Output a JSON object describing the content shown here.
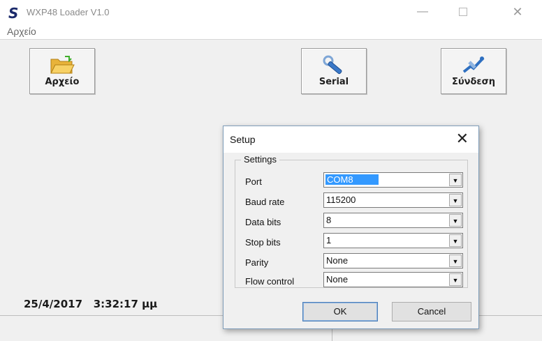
{
  "window": {
    "logo": "S",
    "title": "WXP48 Loader V1.0",
    "controls": {
      "minimize": "—",
      "close": "✕"
    }
  },
  "menu": {
    "items": [
      "Αρχείο"
    ]
  },
  "toolbar": {
    "buttons": [
      {
        "label": "Αρχείο",
        "icon": "folder-open-icon"
      },
      {
        "label": "Serial",
        "icon": "wrench-icon"
      },
      {
        "label": "Σύνδεση",
        "icon": "connection-icon"
      }
    ]
  },
  "status": {
    "date": "25/4/2017",
    "time": "3:32:17 μμ"
  },
  "dialog": {
    "title": "Setup",
    "close": "✕",
    "group_title": "Settings",
    "rows": [
      {
        "label": "Port",
        "value": "COM8"
      },
      {
        "label": "Baud rate",
        "value": "115200"
      },
      {
        "label": "Data bits",
        "value": "8"
      },
      {
        "label": "Stop bits",
        "value": "1"
      },
      {
        "label": "Parity",
        "value": "None"
      },
      {
        "label": "Flow control",
        "value": "None"
      }
    ],
    "ok_label": "OK",
    "cancel_label": "Cancel"
  },
  "colors": {
    "selection": "#3399ff",
    "logo": "#1b2a6b",
    "accent_blue": "#4d7fb8"
  }
}
